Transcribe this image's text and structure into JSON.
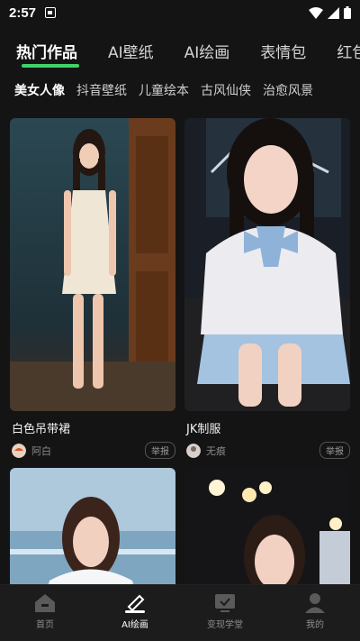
{
  "status": {
    "time": "2:57"
  },
  "categories": [
    {
      "label": "热门作品"
    },
    {
      "label": "AI壁纸"
    },
    {
      "label": "AI绘画"
    },
    {
      "label": "表情包"
    },
    {
      "label": "红包"
    }
  ],
  "subcategories": [
    {
      "label": "美女人像"
    },
    {
      "label": "抖音壁纸"
    },
    {
      "label": "儿童绘本"
    },
    {
      "label": "古风仙侠"
    },
    {
      "label": "治愈风景"
    }
  ],
  "cards": [
    {
      "title": "白色吊带裙",
      "author": "阿白",
      "report": "举报"
    },
    {
      "title": "JK制服",
      "author": "无痕",
      "report": "举报"
    }
  ],
  "nav": [
    {
      "label": "首页",
      "icon": "home-icon"
    },
    {
      "label": "AI绘画",
      "icon": "paint-icon"
    },
    {
      "label": "变现学堂",
      "icon": "classroom-icon"
    },
    {
      "label": "我的",
      "icon": "profile-icon"
    }
  ],
  "colors": {
    "accent": "#3fd36a",
    "background": "#141414"
  }
}
